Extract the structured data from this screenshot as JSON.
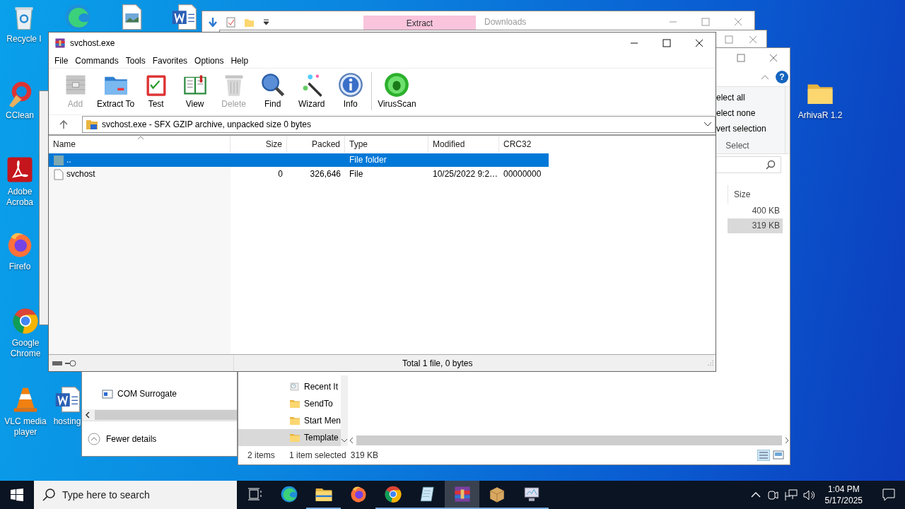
{
  "desktop_icons": [
    {
      "kind": "recycle",
      "label": "Recycle I"
    },
    {
      "kind": "edge"
    },
    {
      "kind": "image"
    },
    {
      "kind": "word"
    },
    {
      "kind": "ccleaner",
      "label": "CClean"
    },
    {
      "kind": "acrobat",
      "label": "Adobe Acroba"
    },
    {
      "kind": "firefox",
      "label": "Firefo"
    },
    {
      "kind": "chrome",
      "label": "Google Chrome"
    },
    {
      "kind": "vlc",
      "label": "VLC media player"
    },
    {
      "kind": "word",
      "label": "hosting"
    },
    {
      "kind": "folder",
      "label": "ArhivaR 1.2"
    }
  ],
  "downloads_window": {
    "title": "Downloads",
    "ribbon_tab": "Extract"
  },
  "explorer_window": {
    "help": "?",
    "ribbon_items": [
      "elect all",
      "elect none",
      "vert selection"
    ],
    "ribbon_group": "Select",
    "columns": [
      "Size"
    ],
    "rows": [
      {
        "size": "400 KB",
        "selected": false
      },
      {
        "size": "319 KB",
        "selected": true
      }
    ],
    "nav_items": [
      {
        "label": "Recent It",
        "kind": "recent",
        "selected": false
      },
      {
        "label": "SendTo",
        "kind": "folder",
        "selected": false
      },
      {
        "label": "Start Men",
        "kind": "folder",
        "selected": false
      },
      {
        "label": "Template",
        "kind": "folder",
        "selected": true
      }
    ],
    "status": [
      "2 items",
      "1 item selected",
      "319 KB"
    ]
  },
  "task_manager": {
    "processes": [
      "COM Surrogate"
    ],
    "toggle": "Fewer details"
  },
  "archive_window": {
    "title": "svchost.exe",
    "menu": [
      "File",
      "Commands",
      "Tools",
      "Favorites",
      "Options",
      "Help"
    ],
    "toolbar": [
      {
        "label": "Add",
        "kind": "add",
        "disabled": true
      },
      {
        "label": "Extract To",
        "kind": "extract",
        "disabled": false
      },
      {
        "label": "Test",
        "kind": "test",
        "disabled": false
      },
      {
        "label": "View",
        "kind": "view",
        "disabled": false
      },
      {
        "label": "Delete",
        "kind": "delete",
        "disabled": true
      },
      {
        "label": "Find",
        "kind": "find",
        "disabled": false
      },
      {
        "label": "Wizard",
        "kind": "wizard",
        "disabled": false
      },
      {
        "label": "Info",
        "kind": "info",
        "disabled": false
      },
      {
        "label": "VirusScan",
        "kind": "virusscan",
        "disabled": false
      }
    ],
    "path": "svchost.exe - SFX GZIP archive, unpacked size 0 bytes",
    "columns": [
      "Name",
      "Size",
      "Packed",
      "Type",
      "Modified",
      "CRC32"
    ],
    "rows": [
      {
        "kind": "folder",
        "name": "..",
        "type": "File folder",
        "selected": true
      },
      {
        "kind": "file",
        "name": "svchost",
        "size": "0",
        "packed": "326,646",
        "type": "File",
        "modified": "10/25/2022 9:2…",
        "crc32": "00000000",
        "selected": false
      }
    ],
    "status": "Total 1 file, 0 bytes"
  },
  "taskbar": {
    "search": {
      "placeholder": "Type here to search"
    },
    "apps": [
      {
        "kind": "edge",
        "running": false,
        "active": false
      },
      {
        "kind": "explorer",
        "running": true,
        "active": false
      },
      {
        "kind": "firefox",
        "running": false,
        "active": false
      },
      {
        "kind": "chrome",
        "running": true,
        "active": false
      },
      {
        "kind": "notepad",
        "running": true,
        "active": false
      },
      {
        "kind": "rar",
        "running": true,
        "active": true
      },
      {
        "kind": "box",
        "running": true,
        "active": false
      },
      {
        "kind": "monitor",
        "running": true,
        "active": false
      }
    ],
    "time": "1:04 PM",
    "date": "5/17/2025"
  }
}
